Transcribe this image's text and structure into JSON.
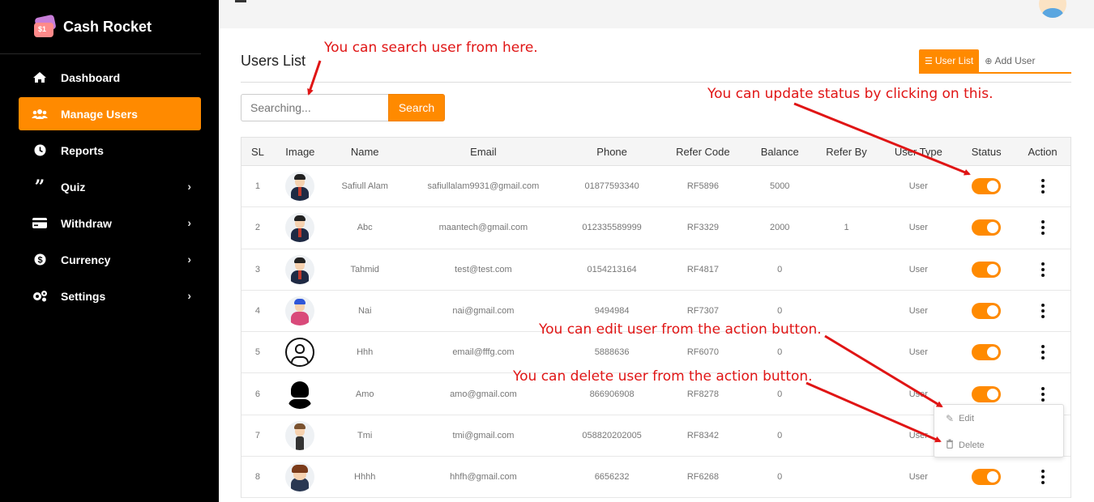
{
  "app": {
    "name": "Cash Rocket"
  },
  "sidebar": {
    "items": [
      {
        "label": "Dashboard",
        "icon": "home-icon",
        "active": false,
        "has_chevron": false
      },
      {
        "label": "Manage Users",
        "icon": "users-icon",
        "active": true,
        "has_chevron": false
      },
      {
        "label": "Reports",
        "icon": "clock-icon",
        "active": false,
        "has_chevron": false
      },
      {
        "label": "Quiz",
        "icon": "quote-icon",
        "active": false,
        "has_chevron": true
      },
      {
        "label": "Withdraw",
        "icon": "credit-card-icon",
        "active": false,
        "has_chevron": true
      },
      {
        "label": "Currency",
        "icon": "dollar-icon",
        "active": false,
        "has_chevron": true
      },
      {
        "label": "Settings",
        "icon": "gears-icon",
        "active": false,
        "has_chevron": true
      }
    ]
  },
  "page": {
    "title": "Users List",
    "tabs": [
      {
        "label": "User List",
        "icon": "list-icon",
        "active": true
      },
      {
        "label": "Add User",
        "icon": "plus-circle-icon",
        "active": false
      }
    ]
  },
  "search": {
    "placeholder": "Searching...",
    "button_label": "Search"
  },
  "table": {
    "headers": [
      "SL",
      "Image",
      "Name",
      "Email",
      "Phone",
      "Refer Code",
      "Balance",
      "Refer By",
      "User Type",
      "Status",
      "Action"
    ],
    "rows": [
      {
        "sl": "1",
        "avatar": "man-suit",
        "name": "Safiull Alam",
        "email": "safiullalam9931@gmail.com",
        "phone": "01877593340",
        "refer_code": "RF5896",
        "balance": "5000",
        "refer_by": "",
        "user_type": "User",
        "status": true
      },
      {
        "sl": "2",
        "avatar": "man-suit",
        "name": "Abc",
        "email": "maantech@gmail.com",
        "phone": "012335589999",
        "refer_code": "RF3329",
        "balance": "2000",
        "refer_by": "1",
        "user_type": "User",
        "status": true
      },
      {
        "sl": "3",
        "avatar": "man-suit",
        "name": "Tahmid",
        "email": "test@test.com",
        "phone": "0154213164",
        "refer_code": "RF4817",
        "balance": "0",
        "refer_by": "",
        "user_type": "User",
        "status": true
      },
      {
        "sl": "4",
        "avatar": "blue-hair",
        "name": "Nai",
        "email": "nai@gmail.com",
        "phone": "9494984",
        "refer_code": "RF7307",
        "balance": "0",
        "refer_by": "",
        "user_type": "User",
        "status": true
      },
      {
        "sl": "5",
        "avatar": "outline",
        "name": "Hhh",
        "email": "email@fffg.com",
        "phone": "5888636",
        "refer_code": "RF6070",
        "balance": "0",
        "refer_by": "",
        "user_type": "User",
        "status": true
      },
      {
        "sl": "6",
        "avatar": "black-silhouette",
        "name": "Amo",
        "email": "amo@gmail.com",
        "phone": "866906908",
        "refer_code": "RF8278",
        "balance": "0",
        "refer_by": "",
        "user_type": "User",
        "status": true
      },
      {
        "sl": "7",
        "avatar": "standing-suit",
        "name": "Tmi",
        "email": "tmi@gmail.com",
        "phone": "058820202005",
        "refer_code": "RF8342",
        "balance": "0",
        "refer_by": "",
        "user_type": "User",
        "status": true
      },
      {
        "sl": "8",
        "avatar": "glasses-man",
        "name": "Hhhh",
        "email": "hhfh@gmail.com",
        "phone": "6656232",
        "refer_code": "RF6268",
        "balance": "0",
        "refer_by": "",
        "user_type": "User",
        "status": true
      }
    ]
  },
  "action_menu": {
    "edit_label": "Edit",
    "delete_label": "Delete"
  },
  "annotations": {
    "search": "You can search user from here.",
    "status": "You can update status by clicking on this.",
    "edit": "You can edit user from the action button.",
    "delete": "You can delete user from the action button."
  },
  "colors": {
    "accent": "#ff8a00",
    "annotation": "#e01515",
    "sidebar_bg": "#000000"
  }
}
